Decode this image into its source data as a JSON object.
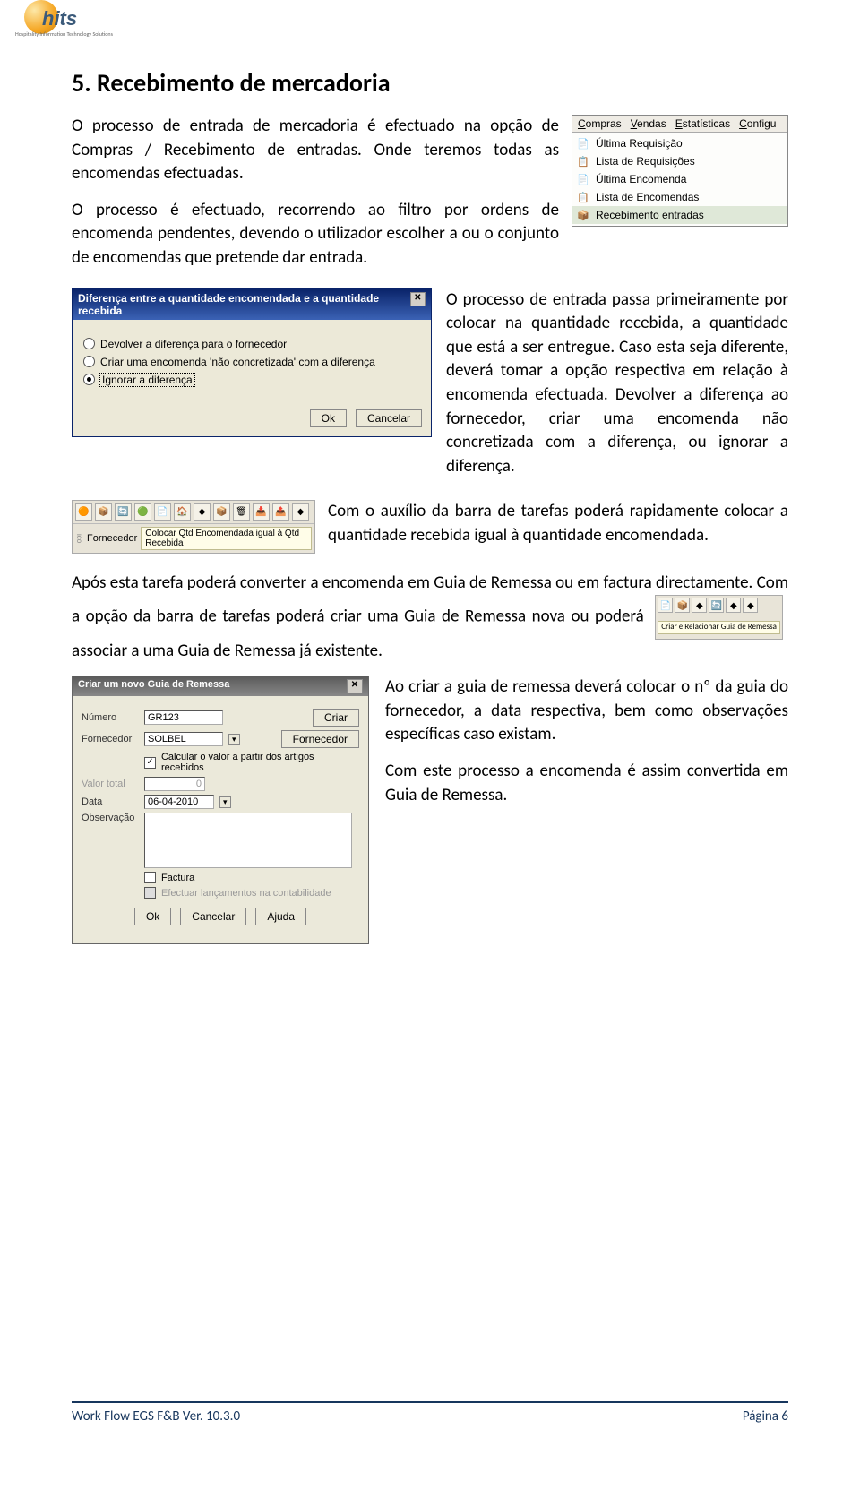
{
  "logo": {
    "brand": "hits",
    "tagline": "Hospitality Information Technology Solutions"
  },
  "section_title": "5. Recebimento de mercadoria",
  "para1": "O processo de entrada de mercadoria é efectuado na opção de Compras / Recebimento de entradas. Onde teremos todas as encomendas efectuadas.",
  "para2": "O processo é efectuado, recorrendo ao filtro por ordens de encomenda pendentes, devendo o utilizador escolher a ou o conjunto de encomendas que pretende dar entrada.",
  "menu": {
    "tabs": [
      "Compras",
      "Vendas",
      "Estatísticas",
      "Configu"
    ],
    "items": [
      {
        "icon": "📄",
        "label": "Última Requisição"
      },
      {
        "icon": "📋",
        "label": "Lista de Requisições"
      },
      {
        "icon": "📄",
        "label": "Última Encomenda"
      },
      {
        "icon": "📋",
        "label": "Lista de Encomendas"
      },
      {
        "icon": "📦",
        "label": "Recebimento entradas",
        "selected": true
      }
    ]
  },
  "dialog1": {
    "title": "Diferença entre a quantidade encomendada e a quantidade recebida",
    "options": [
      {
        "label": "Devolver a diferença para o fornecedor",
        "checked": false
      },
      {
        "label": "Criar uma encomenda 'não concretizada' com a diferença",
        "checked": false
      },
      {
        "label": "Ignorar a diferença",
        "checked": true
      }
    ],
    "ok": "Ok",
    "cancel": "Cancelar"
  },
  "para3": "O processo de entrada passa primeiramente por colocar na quantidade recebida, a quantidade que está a ser entregue. Caso esta seja diferente, deverá tomar a opção respectiva em relação à encomenda efectuada. Devolver a diferença ao fornecedor, criar uma encomenda não concretizada com a diferença, ou ignorar a diferença.",
  "toolbar1": {
    "status": "Colocar Qtd Encomendada igual à Qtd Recebida",
    "label_left": "Fornecedor",
    "label_side": "ico"
  },
  "para4": "Com o auxílio da barra de tarefas poderá rapidamente colocar a quantidade recebida igual à quantidade encomendada.",
  "para5a": "Após esta tarefa poderá converter a encomenda em Guia de Remessa ou em factura directamente. Com a opção da barra de tarefas poderá criar uma Guia de Remessa nova ou poderá",
  "para5b": "associar a uma Guia de Remessa já existente.",
  "toolbar2": {
    "hint": "Criar e Relacionar Guia de Remessa"
  },
  "dialog2": {
    "title": "Criar um novo Guia de Remessa",
    "fields": {
      "numero_lbl": "Número",
      "numero_val": "GR123",
      "fornecedor_lbl": "Fornecedor",
      "fornecedor_val": "SOLBEL",
      "calcular_lbl": "Calcular o valor a partir dos artigos recebidos",
      "valor_lbl": "Valor total",
      "valor_val": "0",
      "data_lbl": "Data",
      "data_val": "06-04-2010",
      "obs_lbl": "Observação",
      "factura_lbl": "Factura",
      "assoc_lbl": "Efectuar lançamentos na contabilidade"
    },
    "btn_criar": "Criar",
    "btn_fornecedor": "Fornecedor",
    "ok": "Ok",
    "cancel": "Cancelar",
    "help": "Ajuda"
  },
  "para6": "Ao criar a guia de remessa deverá colocar o nº da guia do fornecedor, a data respectiva, bem como observações específicas caso existam.",
  "para7": "Com este processo a encomenda é assim convertida em Guia de Remessa.",
  "footer": {
    "left": "Work Flow EGS F&B Ver. 10.3.0",
    "right": "Página 6"
  }
}
